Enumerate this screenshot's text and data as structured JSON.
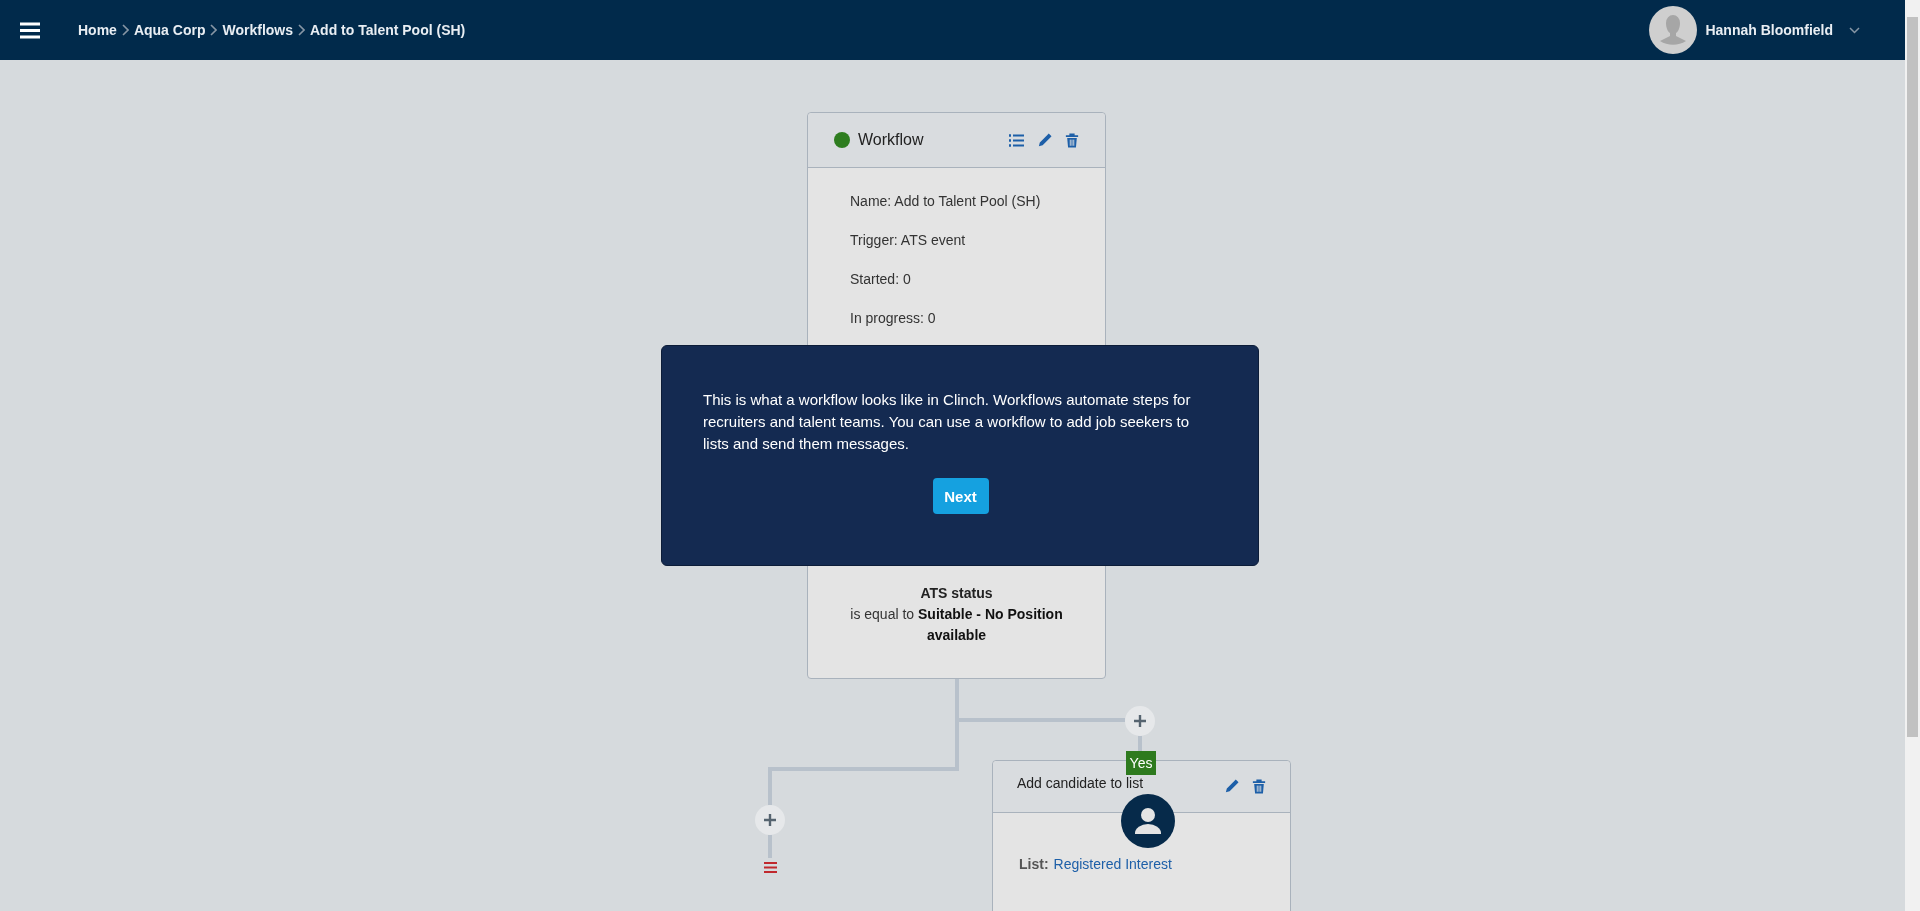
{
  "header": {
    "breadcrumbs": [
      {
        "label": "Home"
      },
      {
        "label": "Aqua Corp"
      },
      {
        "label": "Workflows"
      },
      {
        "label": "Add to Talent Pool (SH)"
      }
    ],
    "user": {
      "name": "Hannah Bloomfield"
    }
  },
  "workflow_card": {
    "title": "Workflow",
    "details": [
      "Name: Add to Talent Pool (SH)",
      "Trigger: ATS event",
      "Started: 0",
      "In progress: 0"
    ],
    "condition": {
      "field": "ATS status",
      "rule": "is equal to **Suitable - No Position available**"
    }
  },
  "branch": {
    "label": "Yes"
  },
  "action_card": {
    "title": "Add candidate to list",
    "detail_label": "List:",
    "detail_value": "Registered Interest"
  },
  "tour": {
    "text": "This is what a workflow looks like in Clinch. Workflows automate steps for recruiters and talent teams. You can use a workflow to add job seekers to lists and send them messages.",
    "button": "Next"
  }
}
